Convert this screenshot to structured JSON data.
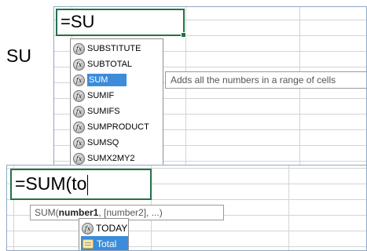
{
  "side_label": "SU",
  "panel1": {
    "formula": "=SU",
    "autocomplete": [
      {
        "label": "SUBSTITUTE",
        "icon": "function-icon",
        "selected": false
      },
      {
        "label": "SUBTOTAL",
        "icon": "function-icon",
        "selected": false
      },
      {
        "label": "SUM",
        "icon": "function-icon",
        "selected": true
      },
      {
        "label": "SUMIF",
        "icon": "function-icon",
        "selected": false
      },
      {
        "label": "SUMIFS",
        "icon": "function-icon",
        "selected": false
      },
      {
        "label": "SUMPRODUCT",
        "icon": "function-icon",
        "selected": false
      },
      {
        "label": "SUMSQ",
        "icon": "function-icon",
        "selected": false
      },
      {
        "label": "SUMX2MY2",
        "icon": "function-icon",
        "selected": false
      }
    ],
    "tooltip": "Adds all the numbers in a range of cells"
  },
  "panel2": {
    "formula": "=SUM(to",
    "tooltip": {
      "prefix": "SUM(",
      "bold_arg": "number1",
      "rest": ", [number2], ...)"
    },
    "autocomplete": [
      {
        "label": "TODAY",
        "icon": "function-icon",
        "selected": false
      },
      {
        "label": "Total",
        "icon": "table-icon",
        "selected": true
      }
    ]
  },
  "colors": {
    "selection": "#3c8cd9",
    "cell_border": "#217346",
    "gridline": "#d4d4d4"
  }
}
